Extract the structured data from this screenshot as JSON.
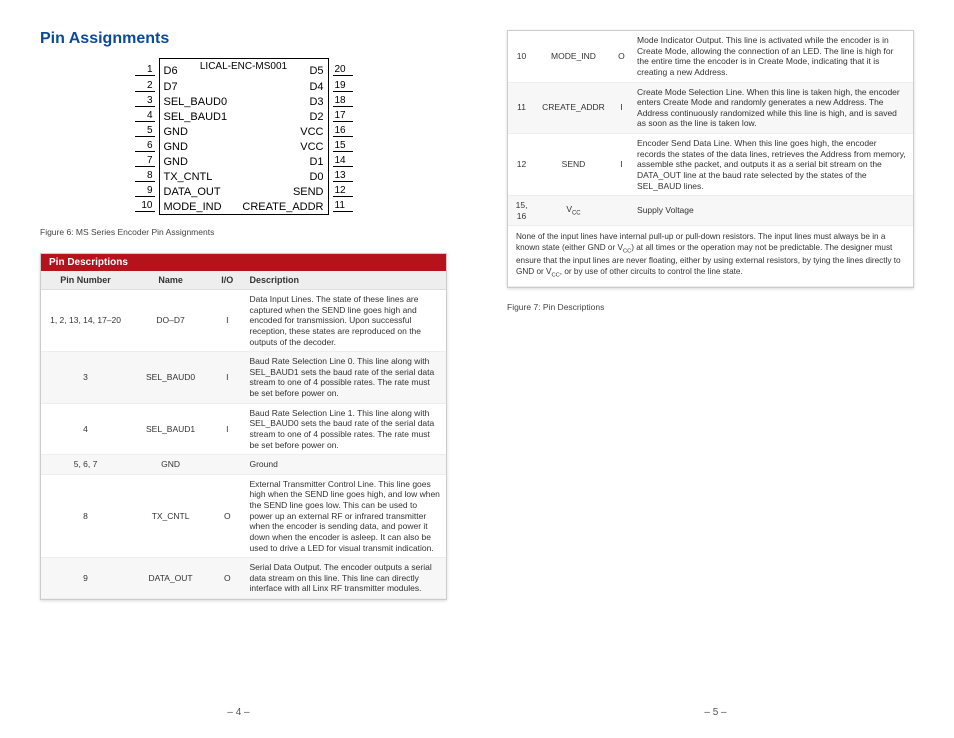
{
  "title": "Pin Assignments",
  "chip": {
    "part": "LICAL-ENC-MS001",
    "left_pins": [
      {
        "n": "1",
        "l": "D6"
      },
      {
        "n": "2",
        "l": "D7"
      },
      {
        "n": "3",
        "l": "SEL_BAUD0"
      },
      {
        "n": "4",
        "l": "SEL_BAUD1"
      },
      {
        "n": "5",
        "l": "GND"
      },
      {
        "n": "6",
        "l": "GND"
      },
      {
        "n": "7",
        "l": "GND"
      },
      {
        "n": "8",
        "l": "TX_CNTL"
      },
      {
        "n": "9",
        "l": "DATA_OUT"
      },
      {
        "n": "10",
        "l": "MODE_IND"
      }
    ],
    "right_pins": [
      {
        "n": "20",
        "l": "D5"
      },
      {
        "n": "19",
        "l": "D4"
      },
      {
        "n": "18",
        "l": "D3"
      },
      {
        "n": "17",
        "l": "D2"
      },
      {
        "n": "16",
        "l": "VCC"
      },
      {
        "n": "15",
        "l": "VCC"
      },
      {
        "n": "14",
        "l": "D1"
      },
      {
        "n": "13",
        "l": "D0"
      },
      {
        "n": "12",
        "l": "SEND"
      },
      {
        "n": "11",
        "l": "CREATE_ADDR"
      }
    ]
  },
  "fig6": "Figure 6: MS Series Encoder Pin Assignments",
  "fig7": "Figure 7: Pin Descriptions",
  "table_title": "Pin Descriptions",
  "headers": {
    "pin": "Pin Number",
    "name": "Name",
    "io": "I/O",
    "desc": "Description"
  },
  "rows_left": [
    {
      "pin": "1, 2, 13, 14, 17–20",
      "name": "DO–D7",
      "io": "I",
      "desc": "Data Input Lines. The state of these lines are captured when the SEND line goes high and encoded for transmission. Upon successful reception, these states are reproduced on the outputs of the decoder."
    },
    {
      "pin": "3",
      "name": "SEL_BAUD0",
      "io": "I",
      "desc": "Baud Rate Selection Line 0. This line along with SEL_BAUD1 sets the baud rate of the serial data stream to one of 4 possible rates. The rate must be set before power on."
    },
    {
      "pin": "4",
      "name": "SEL_BAUD1",
      "io": "I",
      "desc": "Baud Rate Selection Line 1. This line along with SEL_BAUD0 sets the baud rate of the serial data stream to one of 4 possible rates. The rate must be set before power on."
    },
    {
      "pin": "5, 6, 7",
      "name": "GND",
      "io": "",
      "desc": "Ground"
    },
    {
      "pin": "8",
      "name": "TX_CNTL",
      "io": "O",
      "desc": "External Transmitter Control Line. This line goes high when the SEND line goes high, and low when the SEND line goes low. This can be used to power up an external RF or infrared transmitter when the encoder is sending data, and power it down when the encoder is asleep. It can also be used to drive a LED for visual transmit indication."
    },
    {
      "pin": "9",
      "name": "DATA_OUT",
      "io": "O",
      "desc": "Serial Data Output. The encoder outputs a serial data stream on this line. This line can directly interface with all Linx RF transmitter modules."
    }
  ],
  "rows_right": [
    {
      "pin": "10",
      "name": "MODE_IND",
      "io": "O",
      "desc": "Mode Indicator Output. This line is activated while the encoder is in Create Mode, allowing the connection of an LED. The line is high for the entire time the encoder is in Create Mode, indicating that it is creating a new Address."
    },
    {
      "pin": "11",
      "name": "CREATE_ADDR",
      "io": "I",
      "desc": "Create Mode Selection Line. When this line is taken high, the encoder enters Create Mode and randomly generates a new Address. The Address continuously randomized while this line is high, and is saved as soon as the line is taken low."
    },
    {
      "pin": "12",
      "name": "SEND",
      "io": "I",
      "desc": "Encoder Send Data Line. When this line goes high, the encoder records the states of the data lines, retrieves the Address from memory, assemble sthe packet, and outputs it as a serial bit stream on the DATA_OUT line at the baud rate selected by the states of the SEL_BAUD lines."
    },
    {
      "pin": "15, 16",
      "name": "V",
      "io": "",
      "desc": "Supply Voltage",
      "vcc": true
    }
  ],
  "note": "None of the input lines have internal pull-up or pull-down resistors. The input lines must always be in a known state (either GND or V_CC) at all times or the operation may not be predictable. The designer must ensure that the input lines are never floating, either by using external resistors, by tying the lines directly to GND or V_CC, or by use of other circuits to control the line state.",
  "page_left": "– 4 –",
  "page_right": "– 5 –"
}
